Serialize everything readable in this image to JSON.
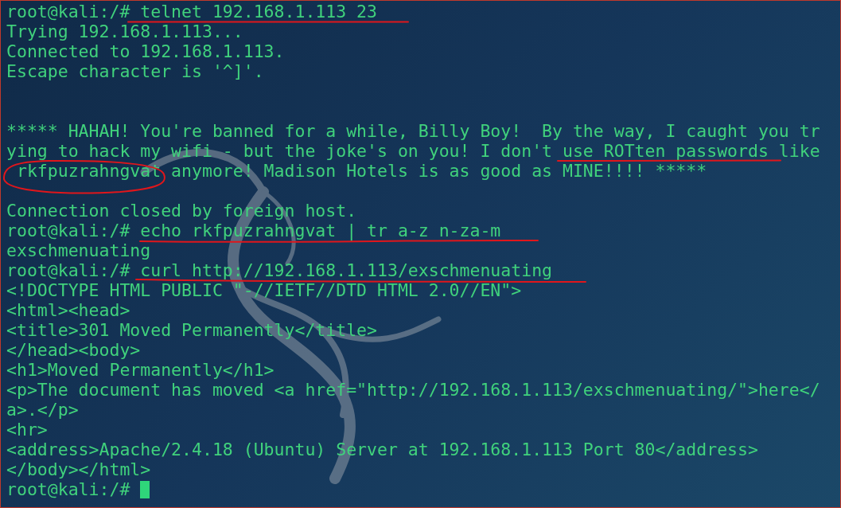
{
  "terminal": {
    "lines": [
      {
        "kind": "text",
        "text": "root@kali:/# telnet 192.168.1.113 23",
        "cursor": false
      },
      {
        "kind": "text",
        "text": "Trying 192.168.1.113...",
        "cursor": false
      },
      {
        "kind": "text",
        "text": "Connected to 192.168.1.113.",
        "cursor": false
      },
      {
        "kind": "text",
        "text": "Escape character is '^]'.",
        "cursor": false
      },
      {
        "kind": "blank"
      },
      {
        "kind": "blank"
      },
      {
        "kind": "text",
        "text": "***** HAHAH! You're banned for a while, Billy Boy!  By the way, I caught you tr",
        "cursor": false
      },
      {
        "kind": "text",
        "text": "ying to hack my wifi - but the joke's on you! I don't use ROTten passwords like",
        "cursor": false
      },
      {
        "kind": "text",
        "text": " rkfpuzrahngvat anymore! Madison Hotels is as good as MINE!!!! *****",
        "cursor": false
      },
      {
        "kind": "blank"
      },
      {
        "kind": "text",
        "text": "Connection closed by foreign host.",
        "cursor": false
      },
      {
        "kind": "text",
        "text": "root@kali:/# echo rkfpuzrahngvat | tr a-z n-za-m",
        "cursor": false
      },
      {
        "kind": "text",
        "text": "exschmenuating",
        "cursor": false
      },
      {
        "kind": "text",
        "text": "root@kali:/# curl http://192.168.1.113/exschmenuating",
        "cursor": false
      },
      {
        "kind": "text",
        "text": "<!DOCTYPE HTML PUBLIC \"-//IETF//DTD HTML 2.0//EN\">",
        "cursor": false
      },
      {
        "kind": "text",
        "text": "<html><head>",
        "cursor": false
      },
      {
        "kind": "text",
        "text": "<title>301 Moved Permanently</title>",
        "cursor": false
      },
      {
        "kind": "text",
        "text": "</head><body>",
        "cursor": false
      },
      {
        "kind": "text",
        "text": "<h1>Moved Permanently</h1>",
        "cursor": false
      },
      {
        "kind": "text",
        "text": "<p>The document has moved <a href=\"http://192.168.1.113/exschmenuating/\">here</",
        "cursor": false
      },
      {
        "kind": "text",
        "text": "a>.</p>",
        "cursor": false
      },
      {
        "kind": "text",
        "text": "<hr>",
        "cursor": false
      },
      {
        "kind": "text",
        "text": "<address>Apache/2.4.18 (Ubuntu) Server at 192.168.1.113 Port 80</address>",
        "cursor": false
      },
      {
        "kind": "text",
        "text": "</body></html>",
        "cursor": false
      },
      {
        "kind": "text",
        "text": "root@kali:/# ",
        "cursor": true
      }
    ]
  }
}
